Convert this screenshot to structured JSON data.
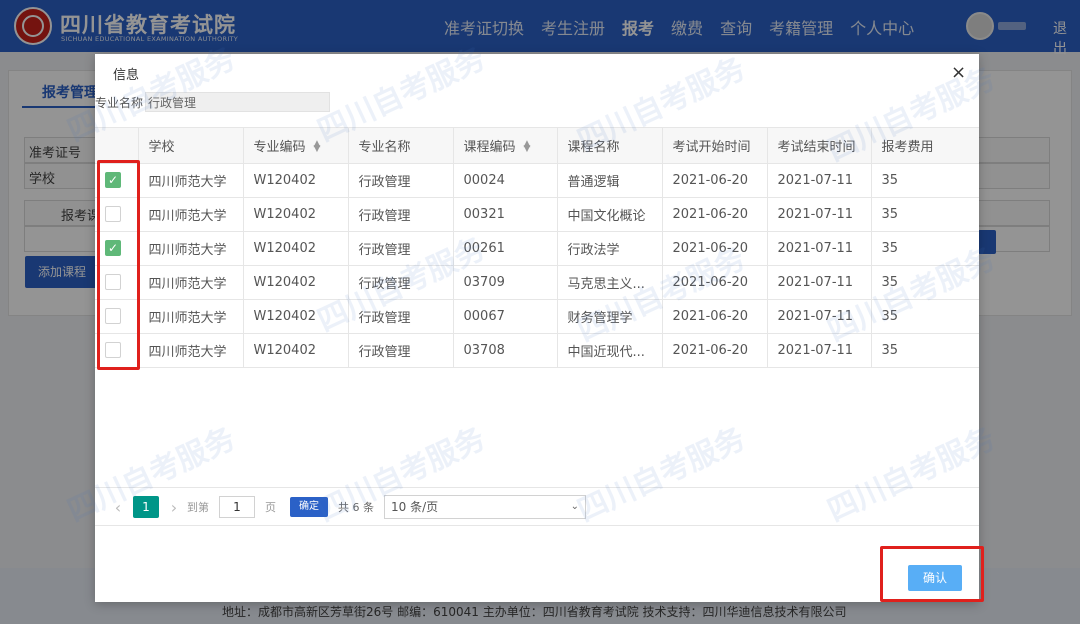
{
  "header": {
    "site_title": "四川省教育考试院",
    "site_subtitle": "SICHUAN EDUCATIONAL EXAMINATION AUTHORITY",
    "nav": [
      "准考证切换",
      "考生注册",
      "报考",
      "缴费",
      "查询",
      "考籍管理",
      "个人中心"
    ],
    "active_nav": "报考",
    "logout": "退出"
  },
  "background": {
    "tab": "报考管理",
    "rows": [
      "准考证号",
      "学校",
      "报考课程"
    ],
    "add_course_button": "添加课程",
    "footer": "地址：成都市高新区芳草街26号 邮编：610041 主办单位：四川省教育考试院 技术支持：四川华迪信息技术有限公司"
  },
  "modal": {
    "title": "信息",
    "close": "×",
    "major_label": "专业名称",
    "major_value": "行政管理",
    "columns": [
      "学校",
      "专业编码",
      "专业名称",
      "课程编码",
      "课程名称",
      "考试开始时间",
      "考试结束时间",
      "报考费用"
    ],
    "rows": [
      {
        "checked": true,
        "school": "四川师范大学",
        "major_code": "W120402",
        "major_name": "行政管理",
        "course_code": "00024",
        "course_name": "普通逻辑",
        "start": "2021-06-20",
        "end": "2021-07-11",
        "fee": "35"
      },
      {
        "checked": false,
        "school": "四川师范大学",
        "major_code": "W120402",
        "major_name": "行政管理",
        "course_code": "00321",
        "course_name": "中国文化概论",
        "start": "2021-06-20",
        "end": "2021-07-11",
        "fee": "35"
      },
      {
        "checked": true,
        "school": "四川师范大学",
        "major_code": "W120402",
        "major_name": "行政管理",
        "course_code": "00261",
        "course_name": "行政法学",
        "start": "2021-06-20",
        "end": "2021-07-11",
        "fee": "35"
      },
      {
        "checked": false,
        "school": "四川师范大学",
        "major_code": "W120402",
        "major_name": "行政管理",
        "course_code": "03709",
        "course_name": "马克思主义...",
        "start": "2021-06-20",
        "end": "2021-07-11",
        "fee": "35"
      },
      {
        "checked": false,
        "school": "四川师范大学",
        "major_code": "W120402",
        "major_name": "行政管理",
        "course_code": "00067",
        "course_name": "财务管理学",
        "start": "2021-06-20",
        "end": "2021-07-11",
        "fee": "35"
      },
      {
        "checked": false,
        "school": "四川师范大学",
        "major_code": "W120402",
        "major_name": "行政管理",
        "course_code": "03708",
        "course_name": "中国近现代...",
        "start": "2021-06-20",
        "end": "2021-07-11",
        "fee": "35"
      }
    ],
    "pager": {
      "current_page": "1",
      "goto_label": "到第",
      "goto_value": "1",
      "page_unit": "页",
      "ok": "确定",
      "total": "共 6 条",
      "page_size": "10 条/页"
    },
    "confirm_button": "确认"
  },
  "watermark": "四川自考服务",
  "colors": {
    "header_blue": "#2b61c7",
    "check_green": "#5fb878",
    "pager_teal": "#009688",
    "highlight_red": "#e0201c",
    "confirm_blue": "#3ba0f5"
  }
}
